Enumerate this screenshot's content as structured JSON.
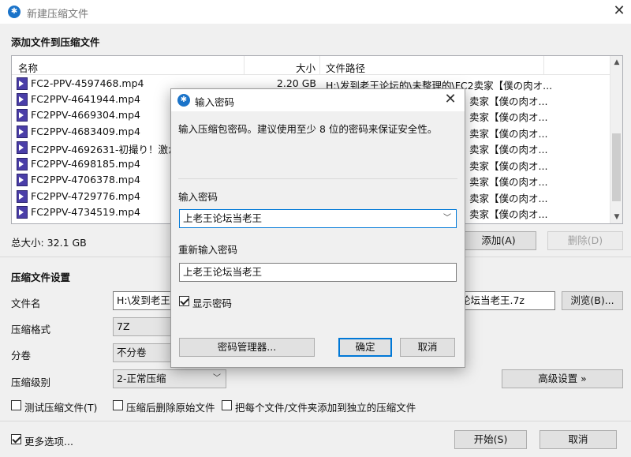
{
  "window": {
    "title": "新建压缩文件",
    "app_icon": "bandizip-icon"
  },
  "files_section": {
    "heading": "添加文件到压缩文件"
  },
  "filelist": {
    "columns": [
      "名称",
      "大小",
      "文件路径"
    ],
    "rows": [
      {
        "name": "FC2-PPV-4597468.mp4",
        "size": "2.20 GB",
        "path": "H:\\发到老王论坛的\\未整理的\\FC2卖家【僕の肉オ..."
      },
      {
        "name": "FC2PPV-4641944.mp4",
        "size": "",
        "path": "卖家【僕の肉オ..."
      },
      {
        "name": "FC2PPV-4669304.mp4",
        "size": "",
        "path": "卖家【僕の肉オ..."
      },
      {
        "name": "FC2PPV-4683409.mp4",
        "size": "",
        "path": "卖家【僕の肉オ..."
      },
      {
        "name": "FC2PPV-4692631-初撮り！激かわ",
        "size": "",
        "path": "卖家【僕の肉オ..."
      },
      {
        "name": "FC2PPV-4698185.mp4",
        "size": "",
        "path": "卖家【僕の肉オ..."
      },
      {
        "name": "FC2PPV-4706378.mp4",
        "size": "",
        "path": "卖家【僕の肉オ..."
      },
      {
        "name": "FC2PPV-4729776.mp4",
        "size": "",
        "path": "卖家【僕の肉オ..."
      },
      {
        "name": "FC2PPV-4734519.mp4",
        "size": "",
        "path": "卖家【僕の肉オ..."
      }
    ]
  },
  "total_size": "总大小: 32.1 GB",
  "buttons": {
    "add": "添加(A)",
    "delete": "删除(D)",
    "browse": "浏览(B)...",
    "advanced": "高级设置 »",
    "start": "开始(S)",
    "cancel": "取消"
  },
  "settings": {
    "heading": "压缩文件设置",
    "filename_label": "文件名",
    "filename_value_left": "H:\\发到老王论",
    "filename_value_right": "论坛当老王.7z",
    "format_label": "压缩格式",
    "format_value": "7Z",
    "split_label": "分卷",
    "split_value": "不分卷",
    "level_label": "压缩级别",
    "level_value": "2-正常压缩"
  },
  "options": {
    "test": "测试压缩文件(T)",
    "delete_original": "压缩后删除原始文件",
    "separate": "把每个文件/文件夹添加到独立的压缩文件",
    "more": "更多选项..."
  },
  "dialog": {
    "title": "输入密码",
    "description": "输入压缩包密码。建议使用至少 8 位的密码来保证安全性。",
    "password_label": "输入密码",
    "password_value": "上老王论坛当老王",
    "confirm_label": "重新输入密码",
    "confirm_value": "上老王论坛当老王",
    "show_password": "显示密码",
    "manager_button": "密码管理器...",
    "ok_button": "确定",
    "cancel_button": "取消"
  }
}
